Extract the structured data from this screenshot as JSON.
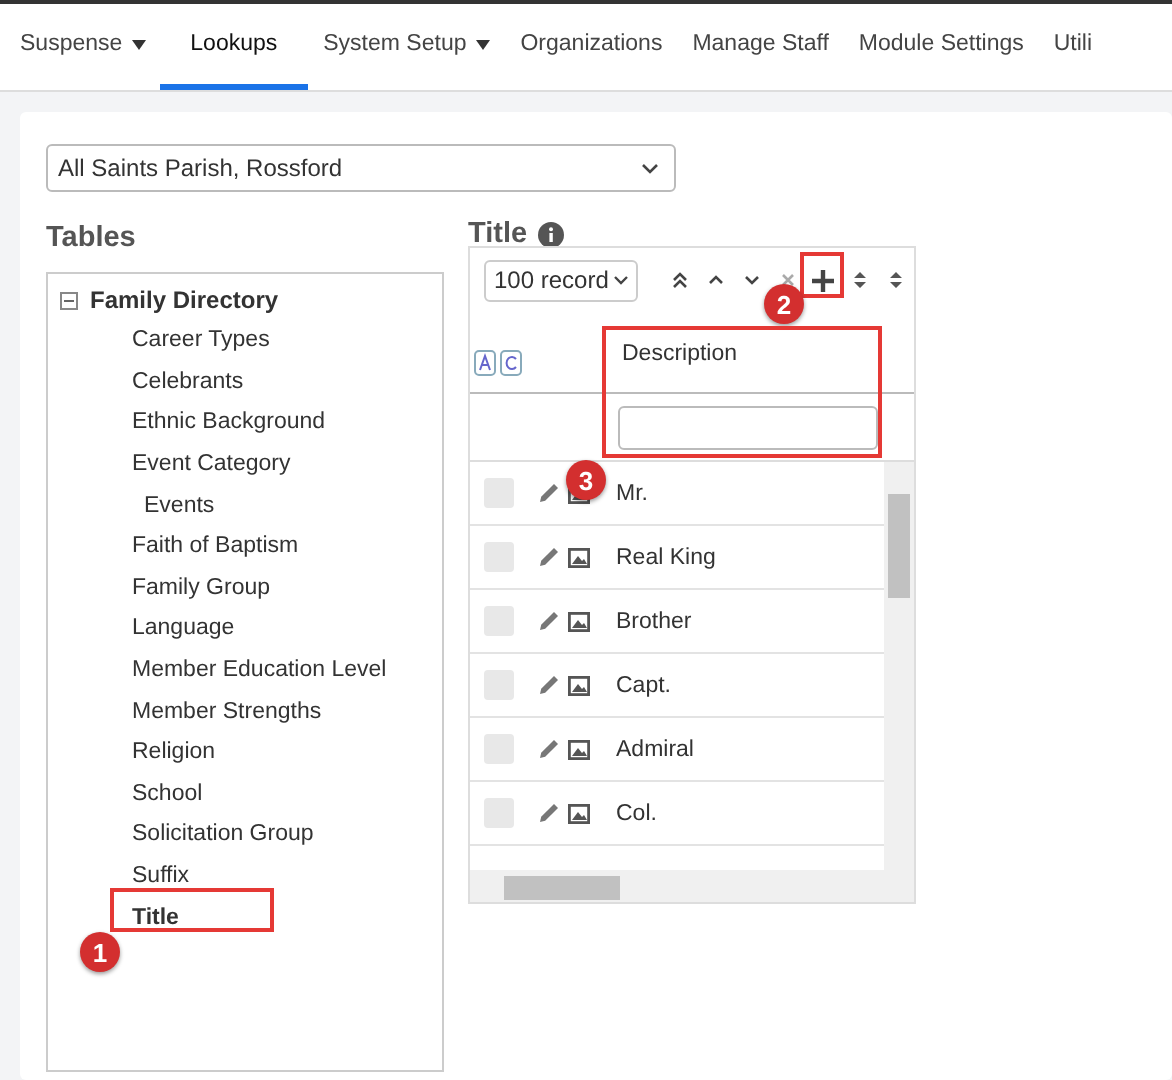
{
  "nav": {
    "items": [
      {
        "label": "Suspense",
        "dropdown": true,
        "selected": false
      },
      {
        "label": "Lookups",
        "dropdown": false,
        "selected": true
      },
      {
        "label": "System Setup",
        "dropdown": true,
        "selected": false
      },
      {
        "label": "Organizations",
        "dropdown": false,
        "selected": false
      },
      {
        "label": "Manage Staff",
        "dropdown": false,
        "selected": false
      },
      {
        "label": "Module Settings",
        "dropdown": false,
        "selected": false
      },
      {
        "label": "Utili",
        "dropdown": false,
        "selected": false
      }
    ]
  },
  "parish_select": {
    "value": "All Saints Parish, Rossford"
  },
  "tables": {
    "heading": "Tables",
    "tree": [
      {
        "label": "Family Directory",
        "expanded": true,
        "children": [
          {
            "label": "Career Types",
            "selected": false
          },
          {
            "label": "Celebrants",
            "selected": false
          },
          {
            "label": "Ethnic Background",
            "selected": false
          },
          {
            "label": "Event Category",
            "selected": false,
            "children": [
              {
                "label": "Events",
                "selected": false
              }
            ]
          },
          {
            "label": "Faith of Baptism",
            "selected": false
          },
          {
            "label": "Family Group",
            "selected": false
          },
          {
            "label": "Language",
            "selected": false
          },
          {
            "label": "Member Education Level",
            "selected": false
          },
          {
            "label": "Member Strengths",
            "selected": false
          },
          {
            "label": "Religion",
            "selected": false
          },
          {
            "label": "School",
            "selected": false
          },
          {
            "label": "Solicitation Group",
            "selected": false
          },
          {
            "label": "Suffix",
            "selected": false
          },
          {
            "label": "Title",
            "selected": true
          }
        ]
      }
    ]
  },
  "grid": {
    "heading": "Title",
    "page_size": "100 record",
    "column": "Description",
    "rows": [
      {
        "description": "Mr.",
        "checked": false
      },
      {
        "description": "Real King",
        "checked": false
      },
      {
        "description": "Brother",
        "checked": false
      },
      {
        "description": "Capt.",
        "checked": false
      },
      {
        "description": "Admiral",
        "checked": false
      },
      {
        "description": "Col.",
        "checked": false
      }
    ]
  },
  "annotations": [
    {
      "number": "1"
    },
    {
      "number": "2"
    },
    {
      "number": "3"
    }
  ]
}
